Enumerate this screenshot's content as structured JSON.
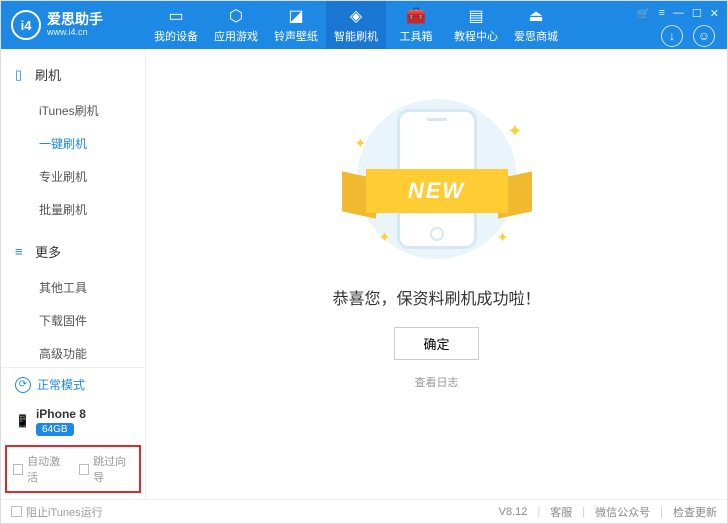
{
  "header": {
    "brand_cn": "爱思助手",
    "brand_url": "www.i4.cn",
    "logo_text": "i4",
    "tabs": [
      {
        "label": "我的设备"
      },
      {
        "label": "应用游戏"
      },
      {
        "label": "铃声壁纸"
      },
      {
        "label": "智能刷机"
      },
      {
        "label": "工具箱"
      },
      {
        "label": "教程中心"
      },
      {
        "label": "爱思商城"
      }
    ]
  },
  "sidebar": {
    "groups": [
      {
        "title": "刷机",
        "items": [
          "iTunes刷机",
          "一键刷机",
          "专业刷机",
          "批量刷机"
        ],
        "activeIndex": 1
      },
      {
        "title": "更多",
        "items": [
          "其他工具",
          "下载固件",
          "高级功能"
        ]
      }
    ],
    "mode": "正常模式",
    "device_name": "iPhone 8",
    "device_badge": "64GB",
    "opt_auto": "自动激活",
    "opt_skip": "跳过向导"
  },
  "main": {
    "ribbon_text": "NEW",
    "success_msg": "恭喜您，保资料刷机成功啦！",
    "ok_label": "确定",
    "log_link": "查看日志"
  },
  "footer": {
    "block_itunes": "阻止iTunes运行",
    "version": "V8.12",
    "service": "客服",
    "wechat": "微信公众号",
    "update": "检查更新"
  }
}
